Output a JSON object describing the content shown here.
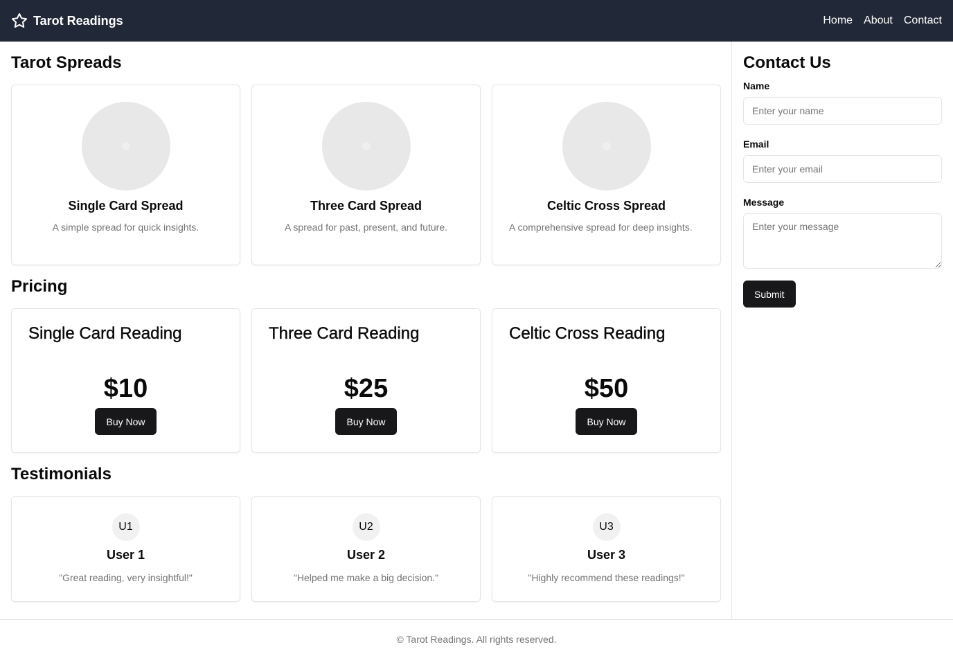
{
  "header": {
    "title": "Tarot Readings",
    "nav": [
      "Home",
      "About",
      "Contact"
    ]
  },
  "spreads": {
    "heading": "Tarot Spreads",
    "items": [
      {
        "title": "Single Card Spread",
        "desc": "A simple spread for quick insights."
      },
      {
        "title": "Three Card Spread",
        "desc": "A spread for past, present, and future."
      },
      {
        "title": "Celtic Cross Spread",
        "desc": "A comprehensive spread for deep insights."
      }
    ]
  },
  "pricing": {
    "heading": "Pricing",
    "items": [
      {
        "title": "Single Card Reading",
        "price": "$10",
        "button": "Buy Now"
      },
      {
        "title": "Three Card Reading",
        "price": "$25",
        "button": "Buy Now"
      },
      {
        "title": "Celtic Cross Reading",
        "price": "$50",
        "button": "Buy Now"
      }
    ]
  },
  "testimonials": {
    "heading": "Testimonials",
    "items": [
      {
        "initials": "U1",
        "name": "User 1",
        "quote": "\"Great reading, very insightful!\""
      },
      {
        "initials": "U2",
        "name": "User 2",
        "quote": "\"Helped me make a big decision.\""
      },
      {
        "initials": "U3",
        "name": "User 3",
        "quote": "\"Highly recommend these readings!\""
      }
    ]
  },
  "contact": {
    "heading": "Contact Us",
    "name_label": "Name",
    "name_placeholder": "Enter your name",
    "email_label": "Email",
    "email_placeholder": "Enter your email",
    "message_label": "Message",
    "message_placeholder": "Enter your message",
    "submit": "Submit"
  },
  "footer": {
    "text": "© Tarot Readings. All rights reserved."
  }
}
